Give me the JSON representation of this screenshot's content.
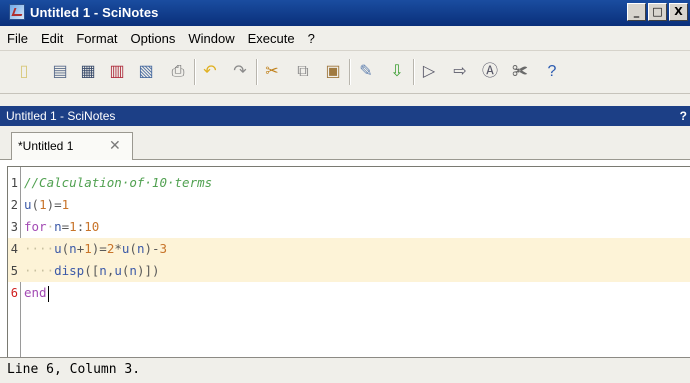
{
  "window": {
    "title": "Untitled 1 - SciNotes",
    "min_label": "_",
    "max_label": "□",
    "close_label": "X"
  },
  "menu": [
    "File",
    "Edit",
    "Format",
    "Options",
    "Window",
    "Execute",
    "?"
  ],
  "toolbar": {
    "icons": [
      {
        "name": "new-file-icon",
        "glyph": "▯",
        "color": "#d8c87a"
      },
      {
        "name": "open-file-icon",
        "glyph": "▤",
        "color": "#5a6c8c"
      },
      {
        "name": "save-icon",
        "glyph": "▦",
        "color": "#3a4c6c"
      },
      {
        "name": "save-as-icon",
        "glyph": "▥",
        "color": "#b03040"
      },
      {
        "name": "save-all-icon",
        "glyph": "▧",
        "color": "#4a6ca0"
      },
      {
        "name": "print-icon",
        "glyph": "⎙",
        "color": "#707070"
      },
      {
        "name": "undo-icon",
        "glyph": "↶",
        "color": "#e0b020"
      },
      {
        "name": "redo-icon",
        "glyph": "↷",
        "color": "#8a8a8a"
      },
      {
        "name": "cut-icon",
        "glyph": "✂",
        "color": "#c0801a"
      },
      {
        "name": "copy-icon",
        "glyph": "⧉",
        "color": "#8a8a8a"
      },
      {
        "name": "paste-icon",
        "glyph": "▣",
        "color": "#a07a40"
      },
      {
        "name": "find-replace-icon",
        "glyph": "✎",
        "color": "#6080b0"
      },
      {
        "name": "load-into-scilab-icon",
        "glyph": "⇩",
        "color": "#3ea035"
      },
      {
        "name": "execute-icon",
        "glyph": "▷",
        "color": "#5a5a6a"
      },
      {
        "name": "execute-with-echo-icon",
        "glyph": "⇨",
        "color": "#5a5a6a"
      },
      {
        "name": "format-icon",
        "glyph": "Ⓐ",
        "color": "#5a5a6a"
      },
      {
        "name": "preferences-icon",
        "glyph": "✀",
        "color": "#6a6a6a"
      },
      {
        "name": "help-icon",
        "glyph": "?",
        "color": "#2a5ab0"
      }
    ]
  },
  "document": {
    "header_title": "Untitled 1 - SciNotes",
    "help_mark": "?"
  },
  "tab": {
    "label": "*Untitled 1",
    "close_glyph": "✕"
  },
  "editor": {
    "lines": [
      {
        "n": "1",
        "tokens": [
          {
            "t": "//Calculation·of·10·terms",
            "c": "comment"
          }
        ]
      },
      {
        "n": "2",
        "tokens": [
          {
            "t": "u",
            "c": "fn"
          },
          {
            "t": "(",
            "c": "op"
          },
          {
            "t": "1",
            "c": "num"
          },
          {
            "t": ")=",
            "c": "op"
          },
          {
            "t": "1",
            "c": "num"
          }
        ]
      },
      {
        "n": "3",
        "tokens": [
          {
            "t": "for",
            "c": "kw"
          },
          {
            "t": "·",
            "c": "ws"
          },
          {
            "t": "n",
            "c": "fn"
          },
          {
            "t": "=",
            "c": "op"
          },
          {
            "t": "1",
            "c": "num"
          },
          {
            "t": ":",
            "c": "op"
          },
          {
            "t": "10",
            "c": "num"
          }
        ]
      },
      {
        "n": "4",
        "hl": true,
        "tokens": [
          {
            "t": "····",
            "c": "ws"
          },
          {
            "t": "u",
            "c": "fn"
          },
          {
            "t": "(",
            "c": "op"
          },
          {
            "t": "n",
            "c": "fn"
          },
          {
            "t": "+",
            "c": "op"
          },
          {
            "t": "1",
            "c": "num"
          },
          {
            "t": ")=",
            "c": "op"
          },
          {
            "t": "2",
            "c": "num"
          },
          {
            "t": "*",
            "c": "op"
          },
          {
            "t": "u",
            "c": "fn"
          },
          {
            "t": "(",
            "c": "op"
          },
          {
            "t": "n",
            "c": "fn"
          },
          {
            "t": ")-",
            "c": "op"
          },
          {
            "t": "3",
            "c": "num"
          }
        ]
      },
      {
        "n": "5",
        "hl": true,
        "tokens": [
          {
            "t": "····",
            "c": "ws"
          },
          {
            "t": "disp",
            "c": "fn"
          },
          {
            "t": "([",
            "c": "op"
          },
          {
            "t": "n",
            "c": "fn"
          },
          {
            "t": ",",
            "c": "op"
          },
          {
            "t": "u",
            "c": "fn"
          },
          {
            "t": "(",
            "c": "op"
          },
          {
            "t": "n",
            "c": "fn"
          },
          {
            "t": ")])",
            "c": "op"
          }
        ]
      },
      {
        "n": "6",
        "current": true,
        "tokens": [
          {
            "t": "end",
            "c": "kw"
          }
        ]
      }
    ]
  },
  "status": {
    "text": "Line 6, Column 3."
  },
  "colors": {
    "title_bar": "#0a2f7a",
    "doc_bar": "#1c3f86",
    "highlight": "#fdf3d7",
    "keyword": "#a34bb4",
    "comment": "#51a151",
    "number": "#c8742a"
  }
}
